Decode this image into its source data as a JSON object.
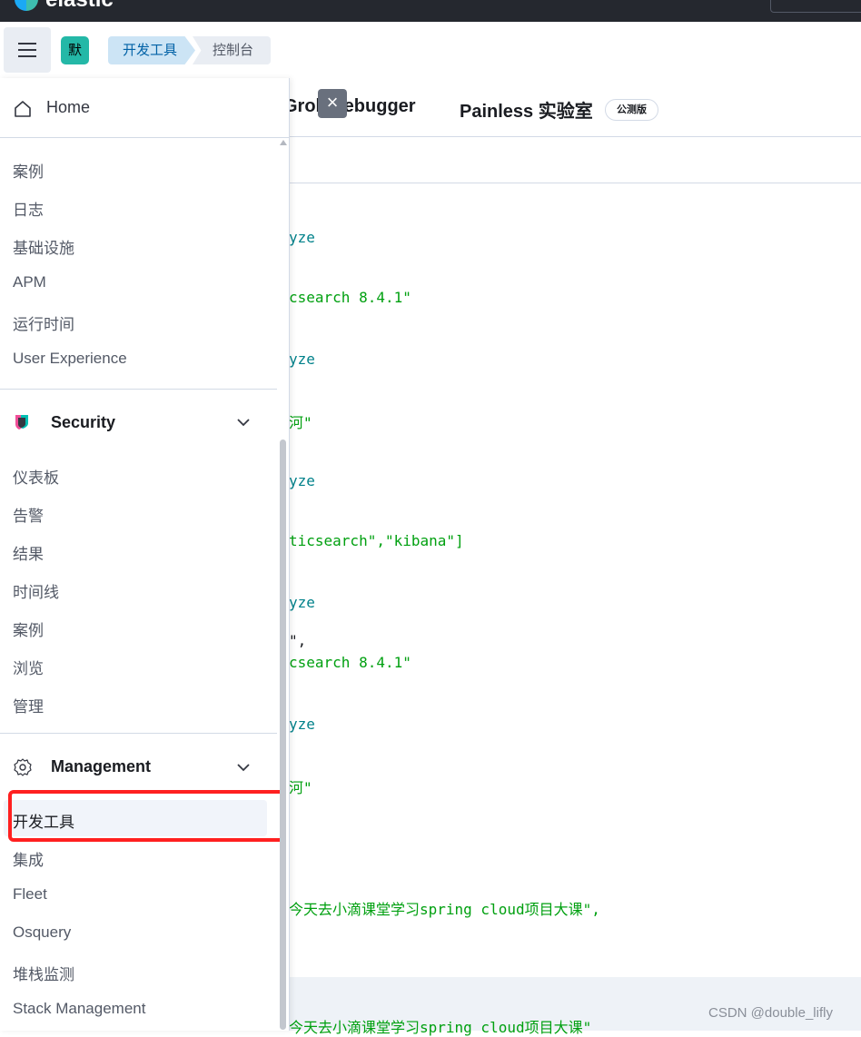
{
  "topbar": {
    "brand": "elastic"
  },
  "header": {
    "space_initial": "默",
    "breadcrumbs": [
      "开发工具",
      "控制台"
    ]
  },
  "tabs": {
    "grok": "Grok Debugger",
    "painless": "Painless 实验室",
    "beta_badge": "公测版"
  },
  "code_lines": [
    "yze",
    "csearch 8.4.1\"",
    "yze",
    "河\"",
    "yze",
    "ticsearch\",\"kibana\"]",
    "yze",
    "\",",
    "csearch 8.4.1\"",
    "yze",
    "河\"",
    "今天去小滴课堂学习spring cloud项目大课\",",
    "今天去小滴课堂学习spring cloud项目大课\""
  ],
  "nav": {
    "home": "Home",
    "top_items": [
      "案例",
      "日志",
      "基础设施",
      "APM",
      "运行时间",
      "User Experience"
    ],
    "security": {
      "title": "Security",
      "items": [
        "仪表板",
        "告警",
        "结果",
        "时间线",
        "案例",
        "浏览",
        "管理"
      ]
    },
    "management": {
      "title": "Management",
      "items": [
        "开发工具",
        "集成",
        "Fleet",
        "Osquery",
        "堆栈监测",
        "Stack Management"
      ]
    }
  },
  "colors": {
    "highlight": "#ff2020",
    "space_badge": "#24b8a7",
    "breadcrumb_active": "#cce4f5",
    "code_string": "#00a010",
    "code_keyword": "#00818a"
  },
  "watermark": "CSDN @double_lifly"
}
